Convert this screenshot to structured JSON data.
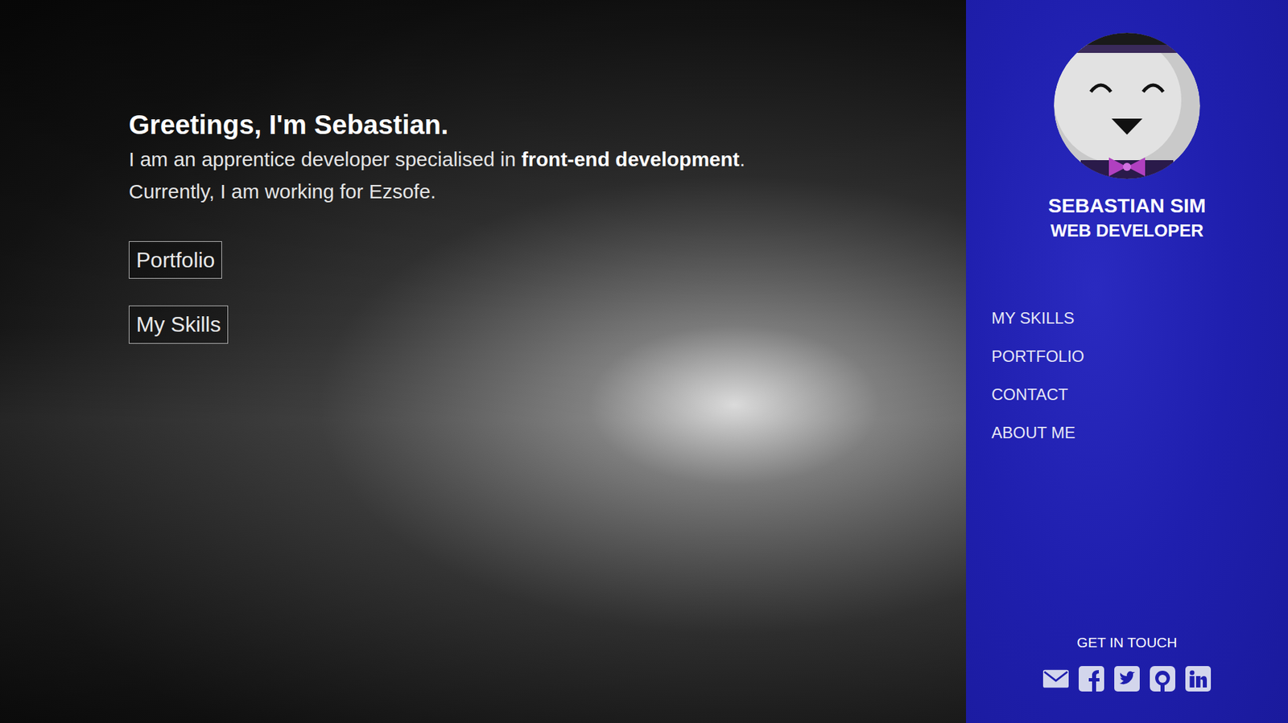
{
  "hero": {
    "title": "Greetings, I'm Sebastian.",
    "lines": [
      [
        {
          "text": "I am an apprentice developer specialised in ",
          "bold": false
        },
        {
          "text": "front-end development",
          "bold": true
        },
        {
          "text": ".",
          "bold": false
        }
      ],
      [
        {
          "text": "Currently, I am working for Ezsofe.",
          "bold": false
        }
      ]
    ],
    "buttons": [
      "Portfolio",
      "My Skills"
    ]
  },
  "sidebar": {
    "name": "SEBASTIAN SIM",
    "role": "WEB DEVELOPER",
    "nav": [
      "MY SKILLS",
      "PORTFOLIO",
      "CONTACT",
      "ABOUT ME"
    ],
    "contact_heading": "GET IN TOUCH",
    "social": [
      {
        "kind": "email"
      },
      {
        "kind": "facebook"
      },
      {
        "kind": "twitter"
      },
      {
        "kind": "github"
      },
      {
        "kind": "linkedin"
      }
    ]
  }
}
